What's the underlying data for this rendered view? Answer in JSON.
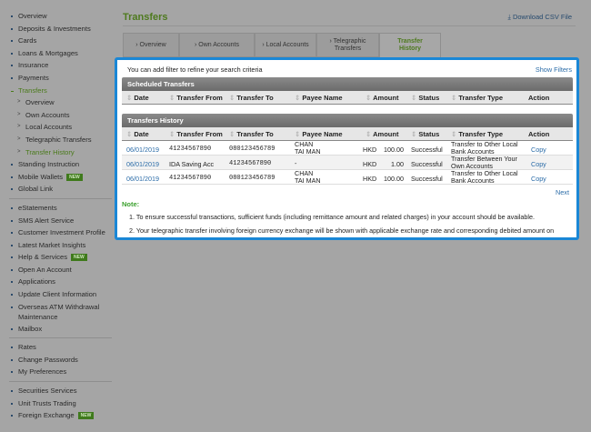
{
  "sidebar": {
    "items": [
      {
        "label": "Overview"
      },
      {
        "label": "Deposits & Investments"
      },
      {
        "label": "Cards"
      },
      {
        "label": "Loans & Mortgages"
      },
      {
        "label": "Insurance"
      },
      {
        "label": "Payments"
      },
      {
        "label": "Transfers"
      },
      {
        "label": "Overview"
      },
      {
        "label": "Own Accounts"
      },
      {
        "label": "Local Accounts"
      },
      {
        "label": "Telegraphic Transfers"
      },
      {
        "label": "Transfer History"
      },
      {
        "label": "Standing Instruction"
      },
      {
        "label": "Mobile Wallets",
        "badge": "NEW"
      },
      {
        "label": "Global Link"
      },
      {
        "label": "eStatements"
      },
      {
        "label": "SMS Alert Service"
      },
      {
        "label": "Customer Investment Profile"
      },
      {
        "label": "Latest Market Insights"
      },
      {
        "label": "Help & Services",
        "badge": "NEW"
      },
      {
        "label": "Open An Account"
      },
      {
        "label": "Applications"
      },
      {
        "label": "Update Client Information"
      },
      {
        "label": "Overseas ATM Withdrawal Maintenance"
      },
      {
        "label": "Mailbox"
      },
      {
        "label": "Rates"
      },
      {
        "label": "Change Passwords"
      },
      {
        "label": "My Preferences"
      },
      {
        "label": "Securities Services"
      },
      {
        "label": "Unit Trusts Trading"
      },
      {
        "label": "Foreign Exchange",
        "badge": "NEW"
      }
    ]
  },
  "header": {
    "title": "Transfers",
    "download": "Download CSV File"
  },
  "tabs": [
    {
      "label": "› Overview"
    },
    {
      "label": "› Own Accounts"
    },
    {
      "label": "› Local Accounts"
    },
    {
      "label": "› Telegraphic Transfers"
    },
    {
      "label": "Transfer History"
    }
  ],
  "main": {
    "filter_hint": "You can add filter to refine your search criteria",
    "show_filters": "Show Filters",
    "scheduled_title": "Scheduled Transfers",
    "history_title": "Transfers History",
    "columns": [
      "Date",
      "Transfer From",
      "Transfer To",
      "Payee Name",
      "Amount",
      "Status",
      "Transfer Type",
      "Action"
    ],
    "rows": [
      {
        "date": "06/01/2019",
        "from": "41234567890",
        "to": "080123456789",
        "payee": "CHAN TAI MAN",
        "currency": "HKD",
        "amount": "100.00",
        "status": "Successful",
        "type": "Transfer to Other Local Bank Accounts",
        "action": "Copy"
      },
      {
        "date": "06/01/2019",
        "from": "IDA Saving Acc",
        "to": "41234567890",
        "payee": "-",
        "currency": "HKD",
        "amount": "1.00",
        "status": "Successful",
        "type": "Transfer Between Your Own Accounts",
        "action": "Copy"
      },
      {
        "date": "06/01/2019",
        "from": "41234567890",
        "to": "080123456789",
        "payee": "CHAN TAI MAN",
        "currency": "HKD",
        "amount": "100.00",
        "status": "Successful",
        "type": "Transfer to Other Local Bank Accounts",
        "action": "Copy"
      }
    ],
    "next": "Next",
    "note_title": "Note:",
    "notes": [
      "1. To ensure successful transactions, sufficient funds (including remittance amount and related charges) in your account should be available.",
      "2. Your telegraphic transfer involving foreign currency exchange will be shown with applicable exchange rate and corresponding debited amount on"
    ]
  },
  "colors": {
    "accent": "#1a87d6",
    "green": "#4e7a1e"
  }
}
